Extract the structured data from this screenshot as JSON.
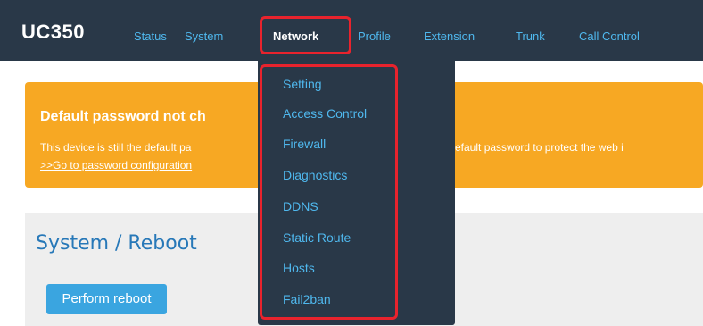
{
  "brand": "UC350",
  "nav": {
    "items": [
      {
        "label": "Status"
      },
      {
        "label": "System"
      },
      {
        "label": "Network"
      },
      {
        "label": "Profile"
      },
      {
        "label": "Extension"
      },
      {
        "label": "Trunk"
      },
      {
        "label": "Call Control"
      }
    ]
  },
  "network_menu": {
    "items": [
      {
        "label": "Setting"
      },
      {
        "label": "Access Control"
      },
      {
        "label": "Firewall"
      },
      {
        "label": "Diagnostics"
      },
      {
        "label": "DDNS"
      },
      {
        "label": "Static Route"
      },
      {
        "label": "Hosts"
      },
      {
        "label": "Fail2ban"
      }
    ]
  },
  "warning": {
    "title": "Default password not ch",
    "text_left": "This device is still the default pa",
    "text_right": "efault password to protect the web i",
    "link": ">>Go to password configuration"
  },
  "panel": {
    "title": "System / Reboot",
    "button": "Perform reboot"
  },
  "colors": {
    "navbar": "#293848",
    "nav_link": "#4fb8ee",
    "warning": "#f7a823",
    "title_blue": "#2778b8",
    "button": "#3aa5e0",
    "highlight": "#e8232d"
  }
}
